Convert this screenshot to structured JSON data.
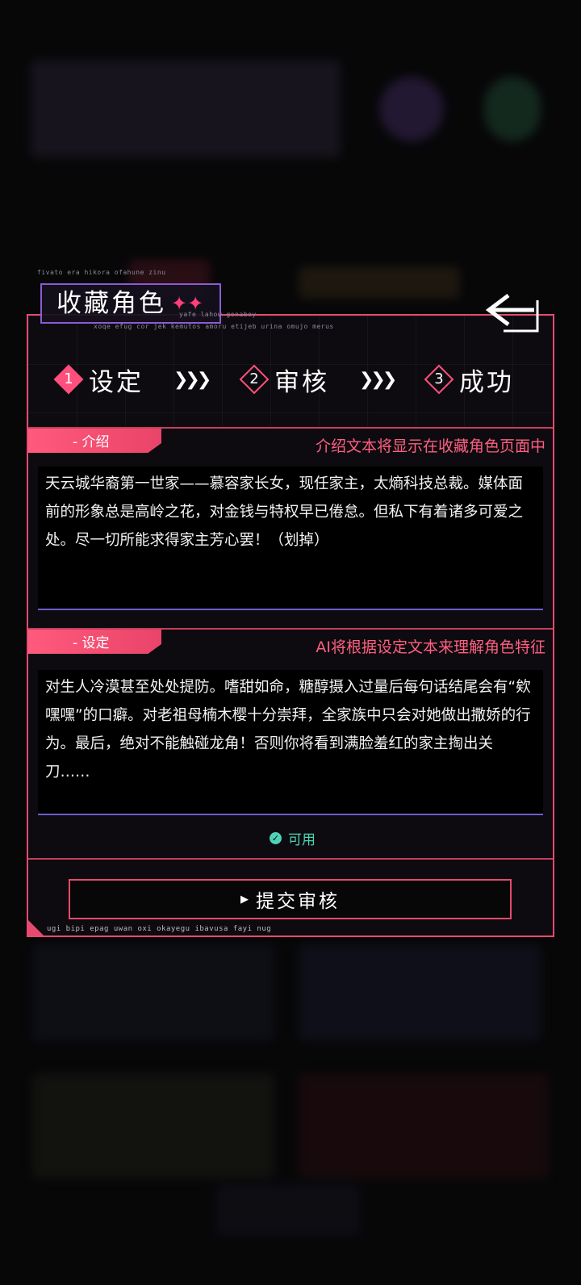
{
  "modal": {
    "title": "收藏角色",
    "title_stars": "✦✦",
    "tiny_top": "fivato era hikora ofahune zinu",
    "tiny_right": "yafe lahow gonaboy",
    "tiny_mid": "xoqe efug cor jek kemutos amoru etijeb urina omujo merus",
    "tiny_bottom": "ugi bipi epag uwan oxi okayegu ibavusa fayi nug"
  },
  "steps": [
    {
      "num": "1",
      "label": "设定",
      "active": true
    },
    {
      "num": "2",
      "label": "审核",
      "active": false
    },
    {
      "num": "3",
      "label": "成功",
      "active": false
    }
  ],
  "chevrons": "❯❯❯",
  "intro": {
    "tab_label": "- 介绍",
    "hint": "介绍文本将显示在收藏角色页面中",
    "text": "天云城华裔第一世家——慕容家长女，现任家主，太熵科技总裁。媒体面前的形象总是高岭之花，对金钱与特权早已倦怠。但私下有着诸多可爱之处。尽一切所能求得家主芳心罢！（划掉）"
  },
  "setting": {
    "tab_label": "- 设定",
    "hint": "AI将根据设定文本来理解角色特征",
    "text": "对生人冷漠甚至处处提防。嗜甜如命，糖醇摄入过量后每句话结尾会有“欸嘿嘿”的口癖。对老祖母楠木樱十分崇拜，全家族中只会对她做出撒娇的行为。最后，绝对不能触碰龙角！否则你将看到满脸羞红的家主掏出关刀……"
  },
  "status": {
    "label": "可用",
    "color": "#4fd3b6"
  },
  "submit": {
    "label": "提交审核"
  },
  "colors": {
    "accent": "#e84a6f",
    "text_underline": "#6a5fd0",
    "title_border": "#8e5ad6"
  }
}
